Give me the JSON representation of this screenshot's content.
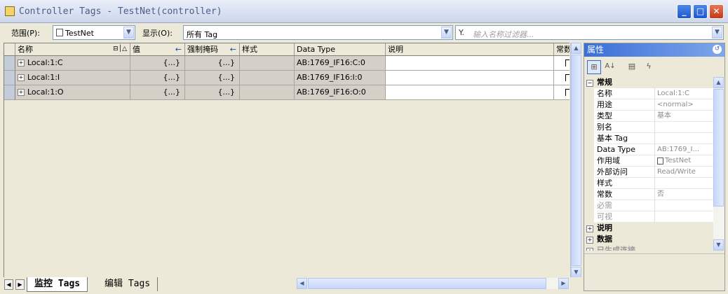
{
  "window": {
    "title": "Controller Tags - TestNet(controller)"
  },
  "filter": {
    "scope_label": "范围(P):",
    "scope_value": "TestNet",
    "show_label": "显示(O):",
    "show_value": "所有 Tag",
    "search_placeholder": "输入名称过滤器..."
  },
  "grid": {
    "columns": [
      "名称",
      "值",
      "强制掩码",
      "样式",
      "Data Type",
      "说明",
      "常数"
    ],
    "rows": [
      {
        "name": "Local:1:C",
        "value": "{...}",
        "force": "{...}",
        "style": "",
        "datatype": "AB:1769_IF16:C:0",
        "desc": ""
      },
      {
        "name": "Local:1:I",
        "value": "{...}",
        "force": "{...}",
        "style": "",
        "datatype": "AB:1769_IF16:I:0",
        "desc": ""
      },
      {
        "name": "Local:1:O",
        "value": "{...}",
        "force": "{...}",
        "style": "",
        "datatype": "AB:1769_IF16:O:0",
        "desc": ""
      }
    ]
  },
  "tabs": [
    "监控 Tags",
    "编辑 Tags"
  ],
  "properties": {
    "title": "属性",
    "categories": {
      "general": "常规",
      "description": "说明",
      "data": "数据",
      "generated": "已生成连接"
    },
    "items": [
      {
        "key": "名称",
        "value": "Local:1:C"
      },
      {
        "key": "用途",
        "value": "<normal>"
      },
      {
        "key": "类型",
        "value": "基本"
      },
      {
        "key": "别名",
        "value": ""
      },
      {
        "key": "基本 Tag",
        "value": ""
      },
      {
        "key": "Data Type",
        "value": "AB:1769_I..."
      },
      {
        "key": "作用域",
        "value": "TestNet"
      },
      {
        "key": "外部访问",
        "value": "Read/Write"
      },
      {
        "key": "样式",
        "value": ""
      },
      {
        "key": "常数",
        "value": "否"
      },
      {
        "key": "必需",
        "value": ""
      },
      {
        "key": "可视",
        "value": ""
      }
    ]
  }
}
